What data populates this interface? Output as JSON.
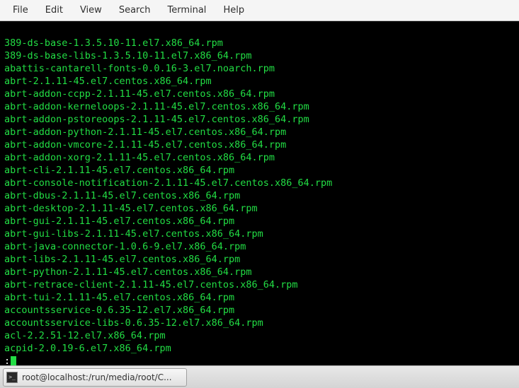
{
  "menubar": {
    "items": [
      "File",
      "Edit",
      "View",
      "Search",
      "Terminal",
      "Help"
    ]
  },
  "terminal": {
    "lines": [
      "389-ds-base-1.3.5.10-11.el7.x86_64.rpm",
      "389-ds-base-libs-1.3.5.10-11.el7.x86_64.rpm",
      "abattis-cantarell-fonts-0.0.16-3.el7.noarch.rpm",
      "abrt-2.1.11-45.el7.centos.x86_64.rpm",
      "abrt-addon-ccpp-2.1.11-45.el7.centos.x86_64.rpm",
      "abrt-addon-kerneloops-2.1.11-45.el7.centos.x86_64.rpm",
      "abrt-addon-pstoreoops-2.1.11-45.el7.centos.x86_64.rpm",
      "abrt-addon-python-2.1.11-45.el7.centos.x86_64.rpm",
      "abrt-addon-vmcore-2.1.11-45.el7.centos.x86_64.rpm",
      "abrt-addon-xorg-2.1.11-45.el7.centos.x86_64.rpm",
      "abrt-cli-2.1.11-45.el7.centos.x86_64.rpm",
      "abrt-console-notification-2.1.11-45.el7.centos.x86_64.rpm",
      "abrt-dbus-2.1.11-45.el7.centos.x86_64.rpm",
      "abrt-desktop-2.1.11-45.el7.centos.x86_64.rpm",
      "abrt-gui-2.1.11-45.el7.centos.x86_64.rpm",
      "abrt-gui-libs-2.1.11-45.el7.centos.x86_64.rpm",
      "abrt-java-connector-1.0.6-9.el7.x86_64.rpm",
      "abrt-libs-2.1.11-45.el7.centos.x86_64.rpm",
      "abrt-python-2.1.11-45.el7.centos.x86_64.rpm",
      "abrt-retrace-client-2.1.11-45.el7.centos.x86_64.rpm",
      "abrt-tui-2.1.11-45.el7.centos.x86_64.rpm",
      "accountsservice-0.6.35-12.el7.x86_64.rpm",
      "accountsservice-libs-0.6.35-12.el7.x86_64.rpm",
      "acl-2.2.51-12.el7.x86_64.rpm",
      "acpid-2.0.19-6.el7.x86_64.rpm"
    ],
    "prompt": ":"
  },
  "taskbar": {
    "button_label": "root@localhost:/run/media/root/C..."
  }
}
